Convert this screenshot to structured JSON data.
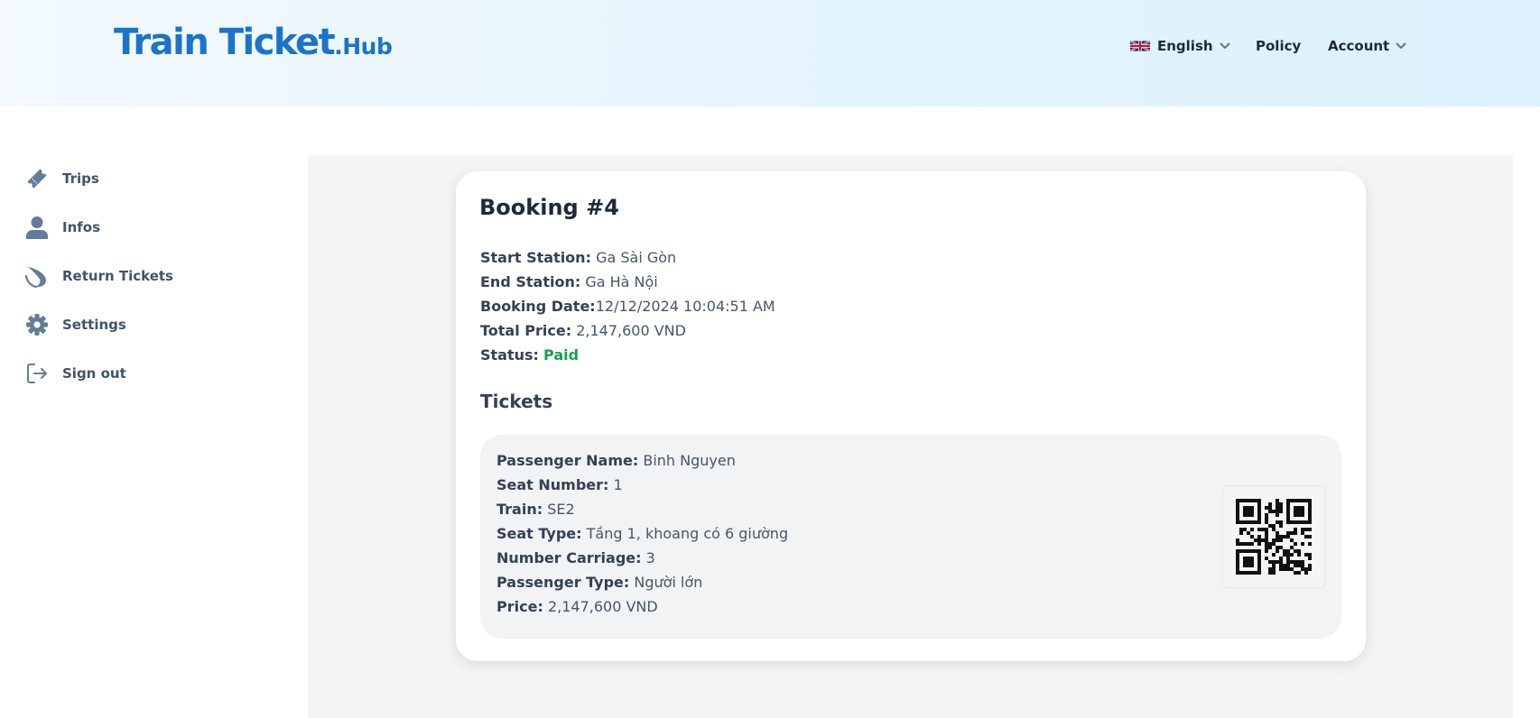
{
  "header": {
    "logo_main": "Train Ticket",
    "logo_dot": ".",
    "logo_sub": "Hub",
    "language": "English",
    "policy": "Policy",
    "account": "Account"
  },
  "sidebar": {
    "items": [
      {
        "label": "Trips",
        "icon": "ticket-icon"
      },
      {
        "label": "Infos",
        "icon": "user-icon"
      },
      {
        "label": "Return Tickets",
        "icon": "return-icon"
      },
      {
        "label": "Settings",
        "icon": "gear-icon"
      },
      {
        "label": "Sign out",
        "icon": "sign-out-icon"
      }
    ]
  },
  "booking": {
    "title": "Booking #4",
    "start_station_label": "Start Station:",
    "start_station": "Ga Sài Gòn",
    "end_station_label": "End Station:",
    "end_station": "Ga Hà Nội",
    "booking_date_label": "Booking Date:",
    "booking_date": "12/12/2024 10:04:51 AM",
    "total_price_label": "Total Price:",
    "total_price": "2,147,600 VND",
    "status_label": "Status:",
    "status": "Paid"
  },
  "tickets": {
    "title": "Tickets",
    "items": [
      {
        "passenger_name_label": "Passenger Name:",
        "passenger_name": "Binh Nguyen",
        "seat_number_label": "Seat Number:",
        "seat_number": "1",
        "train_label": "Train:",
        "train": "SE2",
        "seat_type_label": "Seat Type:",
        "seat_type": "Tầng 1, khoang có 6 giường",
        "number_carriage_label": "Number Carriage:",
        "number_carriage": "3",
        "passenger_type_label": "Passenger Type:",
        "passenger_type": "Người lớn",
        "price_label": "Price:",
        "price": "2,147,600 VND"
      }
    ]
  },
  "colors": {
    "brand": "#1a74c8",
    "status_paid": "#16a34a",
    "sidebar_text": "#3d556b"
  }
}
